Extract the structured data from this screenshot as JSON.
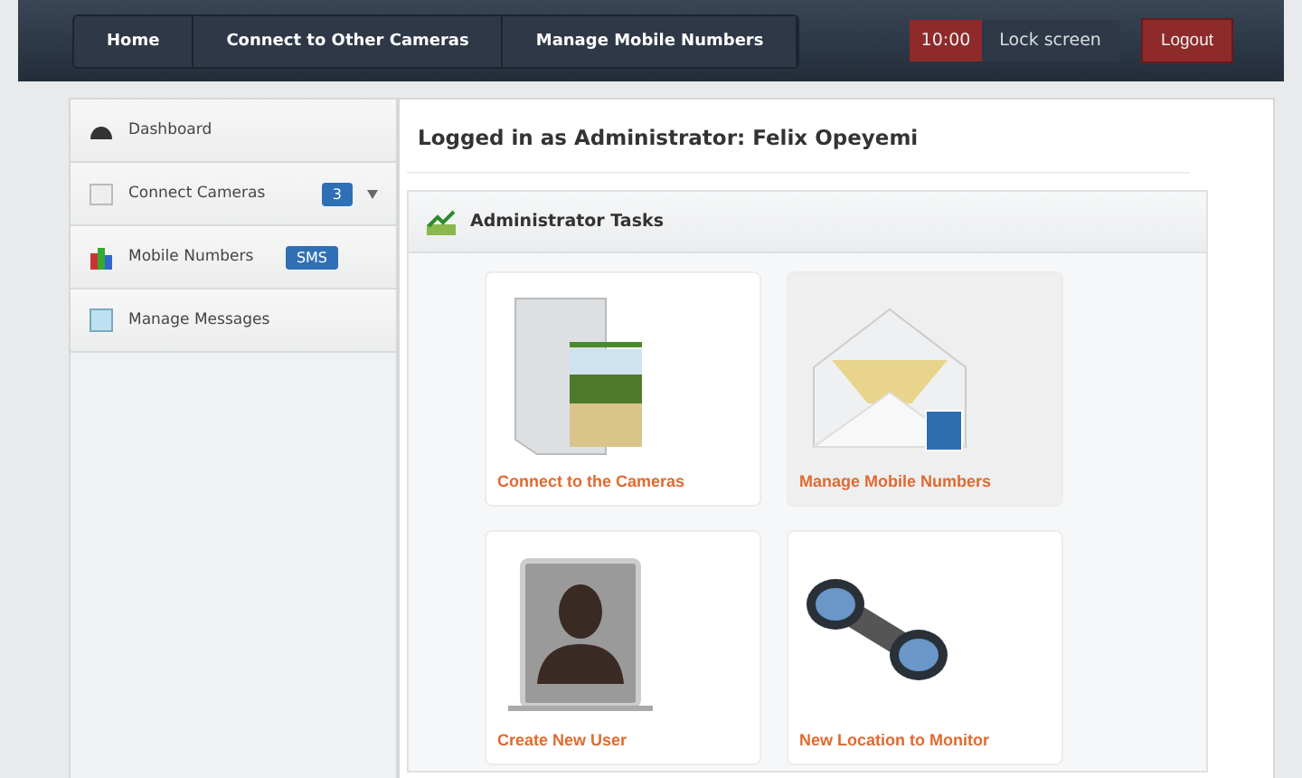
{
  "breadcrumbs": [
    "Home",
    "Connect to Other Cameras",
    "Manage Mobile Numbers"
  ],
  "header": {
    "time": "10:00",
    "lock": "Lock screen",
    "logout": "Logout"
  },
  "sidebar": {
    "items": [
      {
        "label": "Dashboard",
        "kind": "dashboard"
      },
      {
        "label": "Connect Cameras",
        "kind": "cameras",
        "badge": "3"
      },
      {
        "label": "Mobile Numbers",
        "kind": "numbers",
        "badge": "SMS"
      },
      {
        "label": "Manage Messages",
        "kind": "messages"
      }
    ]
  },
  "main": {
    "title": "Logged in as Administrator: Felix Opeyemi",
    "panel_title": "Administrator Tasks",
    "tiles": [
      {
        "label": "Connect to the Cameras",
        "kind": "folder",
        "selected": false
      },
      {
        "label": "Manage Mobile Numbers",
        "kind": "envelope",
        "selected": true
      },
      {
        "label": "Create New User",
        "kind": "user",
        "selected": false
      },
      {
        "label": "New Location to Monitor",
        "kind": "binoculars",
        "selected": false
      }
    ]
  }
}
